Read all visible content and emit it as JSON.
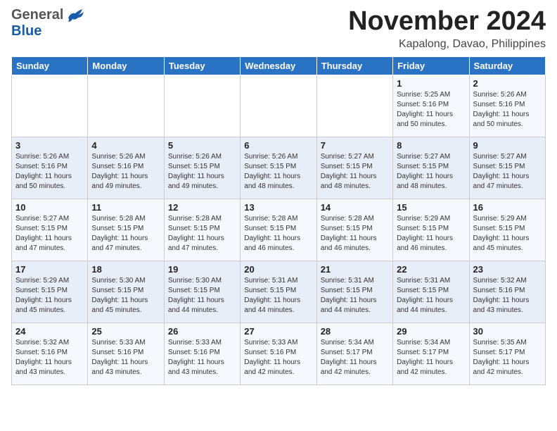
{
  "header": {
    "month_title": "November 2024",
    "location": "Kapalong, Davao, Philippines",
    "logo_general": "General",
    "logo_blue": "Blue"
  },
  "weekdays": [
    "Sunday",
    "Monday",
    "Tuesday",
    "Wednesday",
    "Thursday",
    "Friday",
    "Saturday"
  ],
  "weeks": [
    [
      {
        "day": "",
        "info": ""
      },
      {
        "day": "",
        "info": ""
      },
      {
        "day": "",
        "info": ""
      },
      {
        "day": "",
        "info": ""
      },
      {
        "day": "",
        "info": ""
      },
      {
        "day": "1",
        "info": "Sunrise: 5:25 AM\nSunset: 5:16 PM\nDaylight: 11 hours\nand 50 minutes."
      },
      {
        "day": "2",
        "info": "Sunrise: 5:26 AM\nSunset: 5:16 PM\nDaylight: 11 hours\nand 50 minutes."
      }
    ],
    [
      {
        "day": "3",
        "info": "Sunrise: 5:26 AM\nSunset: 5:16 PM\nDaylight: 11 hours\nand 50 minutes."
      },
      {
        "day": "4",
        "info": "Sunrise: 5:26 AM\nSunset: 5:16 PM\nDaylight: 11 hours\nand 49 minutes."
      },
      {
        "day": "5",
        "info": "Sunrise: 5:26 AM\nSunset: 5:15 PM\nDaylight: 11 hours\nand 49 minutes."
      },
      {
        "day": "6",
        "info": "Sunrise: 5:26 AM\nSunset: 5:15 PM\nDaylight: 11 hours\nand 48 minutes."
      },
      {
        "day": "7",
        "info": "Sunrise: 5:27 AM\nSunset: 5:15 PM\nDaylight: 11 hours\nand 48 minutes."
      },
      {
        "day": "8",
        "info": "Sunrise: 5:27 AM\nSunset: 5:15 PM\nDaylight: 11 hours\nand 48 minutes."
      },
      {
        "day": "9",
        "info": "Sunrise: 5:27 AM\nSunset: 5:15 PM\nDaylight: 11 hours\nand 47 minutes."
      }
    ],
    [
      {
        "day": "10",
        "info": "Sunrise: 5:27 AM\nSunset: 5:15 PM\nDaylight: 11 hours\nand 47 minutes."
      },
      {
        "day": "11",
        "info": "Sunrise: 5:28 AM\nSunset: 5:15 PM\nDaylight: 11 hours\nand 47 minutes."
      },
      {
        "day": "12",
        "info": "Sunrise: 5:28 AM\nSunset: 5:15 PM\nDaylight: 11 hours\nand 47 minutes."
      },
      {
        "day": "13",
        "info": "Sunrise: 5:28 AM\nSunset: 5:15 PM\nDaylight: 11 hours\nand 46 minutes."
      },
      {
        "day": "14",
        "info": "Sunrise: 5:28 AM\nSunset: 5:15 PM\nDaylight: 11 hours\nand 46 minutes."
      },
      {
        "day": "15",
        "info": "Sunrise: 5:29 AM\nSunset: 5:15 PM\nDaylight: 11 hours\nand 46 minutes."
      },
      {
        "day": "16",
        "info": "Sunrise: 5:29 AM\nSunset: 5:15 PM\nDaylight: 11 hours\nand 45 minutes."
      }
    ],
    [
      {
        "day": "17",
        "info": "Sunrise: 5:29 AM\nSunset: 5:15 PM\nDaylight: 11 hours\nand 45 minutes."
      },
      {
        "day": "18",
        "info": "Sunrise: 5:30 AM\nSunset: 5:15 PM\nDaylight: 11 hours\nand 45 minutes."
      },
      {
        "day": "19",
        "info": "Sunrise: 5:30 AM\nSunset: 5:15 PM\nDaylight: 11 hours\nand 44 minutes."
      },
      {
        "day": "20",
        "info": "Sunrise: 5:31 AM\nSunset: 5:15 PM\nDaylight: 11 hours\nand 44 minutes."
      },
      {
        "day": "21",
        "info": "Sunrise: 5:31 AM\nSunset: 5:15 PM\nDaylight: 11 hours\nand 44 minutes."
      },
      {
        "day": "22",
        "info": "Sunrise: 5:31 AM\nSunset: 5:15 PM\nDaylight: 11 hours\nand 44 minutes."
      },
      {
        "day": "23",
        "info": "Sunrise: 5:32 AM\nSunset: 5:16 PM\nDaylight: 11 hours\nand 43 minutes."
      }
    ],
    [
      {
        "day": "24",
        "info": "Sunrise: 5:32 AM\nSunset: 5:16 PM\nDaylight: 11 hours\nand 43 minutes."
      },
      {
        "day": "25",
        "info": "Sunrise: 5:33 AM\nSunset: 5:16 PM\nDaylight: 11 hours\nand 43 minutes."
      },
      {
        "day": "26",
        "info": "Sunrise: 5:33 AM\nSunset: 5:16 PM\nDaylight: 11 hours\nand 43 minutes."
      },
      {
        "day": "27",
        "info": "Sunrise: 5:33 AM\nSunset: 5:16 PM\nDaylight: 11 hours\nand 42 minutes."
      },
      {
        "day": "28",
        "info": "Sunrise: 5:34 AM\nSunset: 5:17 PM\nDaylight: 11 hours\nand 42 minutes."
      },
      {
        "day": "29",
        "info": "Sunrise: 5:34 AM\nSunset: 5:17 PM\nDaylight: 11 hours\nand 42 minutes."
      },
      {
        "day": "30",
        "info": "Sunrise: 5:35 AM\nSunset: 5:17 PM\nDaylight: 11 hours\nand 42 minutes."
      }
    ]
  ]
}
